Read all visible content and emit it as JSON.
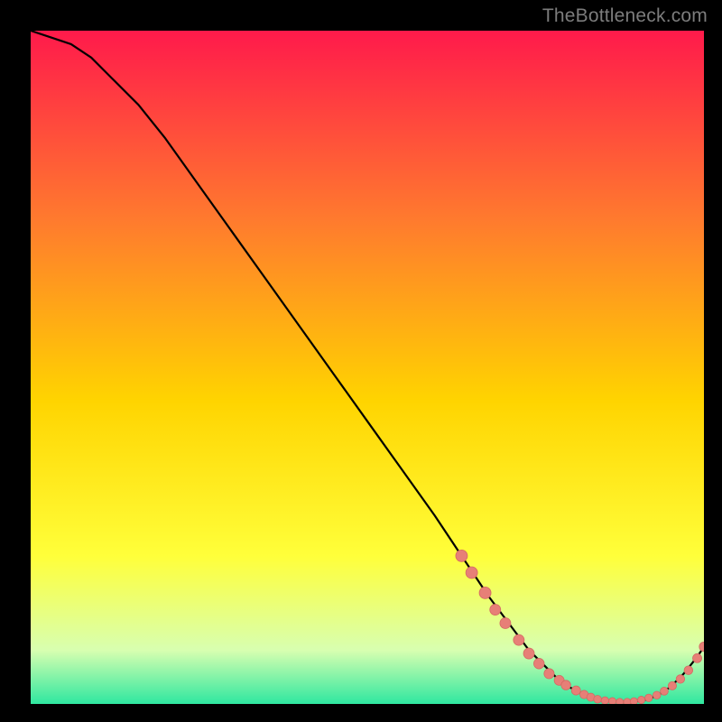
{
  "attribution": "TheBottleneck.com",
  "colors": {
    "gradient_top": "#ff1a4b",
    "gradient_mid1": "#ff7a2e",
    "gradient_mid2": "#ffd400",
    "gradient_mid3": "#ffff3a",
    "gradient_bottom1": "#d8ffb0",
    "gradient_bottom2": "#2fe7a0",
    "curve": "#000000",
    "marker_fill": "#e77f77",
    "marker_stroke": "#d46a62",
    "frame": "#000000"
  },
  "chart_data": {
    "type": "line",
    "title": "",
    "xlabel": "",
    "ylabel": "",
    "xlim": [
      0,
      100
    ],
    "ylim": [
      0,
      100
    ],
    "curve": {
      "x": [
        0,
        3,
        6,
        9,
        12,
        16,
        20,
        25,
        30,
        35,
        40,
        45,
        50,
        55,
        60,
        64,
        68,
        71,
        74,
        77,
        79,
        81,
        83,
        85,
        87,
        89,
        91,
        93,
        95,
        97,
        99,
        100
      ],
      "y": [
        100,
        99,
        98,
        96,
        93,
        89,
        84,
        77,
        70,
        63,
        56,
        49,
        42,
        35,
        28,
        22,
        16,
        12,
        8,
        5,
        3,
        2,
        1,
        0.5,
        0.3,
        0.3,
        0.5,
        1.2,
        2.5,
        4.5,
        7,
        8.5
      ]
    },
    "markers": [
      {
        "x": 64.0,
        "y": 22.0,
        "r": 6.5
      },
      {
        "x": 65.5,
        "y": 19.5,
        "r": 6.5
      },
      {
        "x": 67.5,
        "y": 16.5,
        "r": 6.5
      },
      {
        "x": 69.0,
        "y": 14.0,
        "r": 6.0
      },
      {
        "x": 70.5,
        "y": 12.0,
        "r": 6.0
      },
      {
        "x": 72.5,
        "y": 9.5,
        "r": 6.0
      },
      {
        "x": 74.0,
        "y": 7.5,
        "r": 6.0
      },
      {
        "x": 75.5,
        "y": 6.0,
        "r": 5.8
      },
      {
        "x": 77.0,
        "y": 4.5,
        "r": 5.6
      },
      {
        "x": 78.5,
        "y": 3.5,
        "r": 5.5
      },
      {
        "x": 79.5,
        "y": 2.8,
        "r": 5.3
      },
      {
        "x": 81.0,
        "y": 2.0,
        "r": 5.0
      },
      {
        "x": 82.2,
        "y": 1.4,
        "r": 4.7
      },
      {
        "x": 83.2,
        "y": 1.0,
        "r": 4.5
      },
      {
        "x": 84.2,
        "y": 0.7,
        "r": 4.3
      },
      {
        "x": 85.3,
        "y": 0.5,
        "r": 4.2
      },
      {
        "x": 86.4,
        "y": 0.4,
        "r": 4.1
      },
      {
        "x": 87.5,
        "y": 0.3,
        "r": 4.0
      },
      {
        "x": 88.6,
        "y": 0.3,
        "r": 4.0
      },
      {
        "x": 89.6,
        "y": 0.4,
        "r": 4.0
      },
      {
        "x": 90.7,
        "y": 0.6,
        "r": 4.1
      },
      {
        "x": 91.8,
        "y": 0.9,
        "r": 4.2
      },
      {
        "x": 93.0,
        "y": 1.3,
        "r": 4.3
      },
      {
        "x": 94.1,
        "y": 1.9,
        "r": 4.4
      },
      {
        "x": 95.3,
        "y": 2.7,
        "r": 4.6
      },
      {
        "x": 96.5,
        "y": 3.7,
        "r": 4.7
      },
      {
        "x": 97.7,
        "y": 5.0,
        "r": 4.8
      },
      {
        "x": 99.0,
        "y": 6.8,
        "r": 5.0
      },
      {
        "x": 100.0,
        "y": 8.5,
        "r": 5.2
      }
    ]
  }
}
